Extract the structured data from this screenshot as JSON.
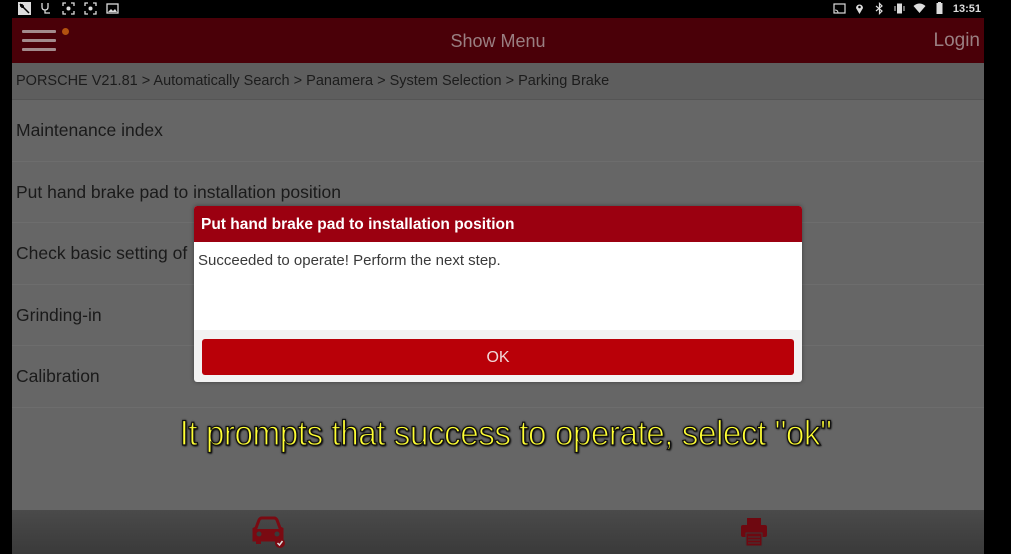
{
  "status_bar": {
    "left_icons": [
      "signal-boost-icon",
      "stethoscope-icon",
      "screenshot-icon",
      "screenshot-icon",
      "image-icon"
    ],
    "right_icons": [
      "cast-icon",
      "location-icon",
      "bluetooth-icon",
      "vibrate-icon",
      "wifi-icon",
      "battery-icon"
    ],
    "time": "13:51"
  },
  "header": {
    "title": "Show Menu",
    "login_label": "Login"
  },
  "breadcrumb": "PORSCHE V21.81 > Automatically Search > Panamera > System Selection > Parking Brake",
  "menu_items": [
    {
      "label": "Maintenance index"
    },
    {
      "label": "Put hand brake pad to installation position"
    },
    {
      "label": "Check basic setting of"
    },
    {
      "label": "Grinding-in"
    },
    {
      "label": "Calibration"
    }
  ],
  "dialog": {
    "title": "Put hand brake pad to installation position",
    "message": "Succeeded to operate! Perform the next step.",
    "ok_label": "OK"
  },
  "caption": "It prompts that success to operate, select \"ok\"",
  "bottom_bar": {
    "icons": [
      "car-check-icon",
      "printer-icon"
    ]
  },
  "colors": {
    "header_bg": "#4a0008",
    "dialog_title_bg": "#9b0010",
    "ok_button_bg": "#b90008",
    "caption_text": "#ffff33"
  }
}
